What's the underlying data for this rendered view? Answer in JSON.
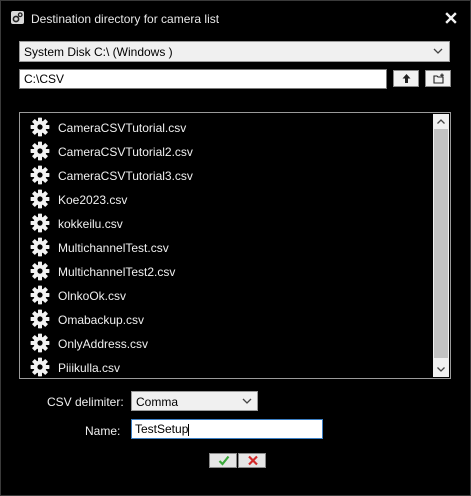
{
  "window": {
    "title": "Destination directory for camera list",
    "title_icon": "gears-icon",
    "close_icon": "close-icon"
  },
  "drive_select": {
    "value": "System Disk C:\\ (Windows )",
    "icon": "chevron-down-icon"
  },
  "path": {
    "value": "C:\\CSV"
  },
  "toolbar": {
    "up_icon": "arrow-up-icon",
    "new_folder_icon": "new-folder-icon"
  },
  "file_list": {
    "item_icon": "gear-icon",
    "items": [
      "CameraCSVTutorial.csv",
      "CameraCSVTutorial2.csv",
      "CameraCSVTutorial3.csv",
      "Koe2023.csv",
      "kokkeilu.csv",
      "MultichannelTest.csv",
      "MultichannelTest2.csv",
      "OlnkoOk.csv",
      "Omabackup.csv",
      "OnlyAddress.csv",
      "Piiikulla.csv"
    ]
  },
  "form": {
    "delimiter_label": "CSV delimiter:",
    "delimiter_value": "Comma",
    "name_label": "Name:",
    "name_value": "TestSetup"
  },
  "actions": {
    "ok_icon": "checkmark-icon",
    "cancel_icon": "x-icon"
  },
  "colors": {
    "background": "#000000",
    "text": "#f0f0f0",
    "ok_green": "#3aa83a",
    "cancel_red": "#d42a2a",
    "focus_border": "#3c7fc4"
  }
}
